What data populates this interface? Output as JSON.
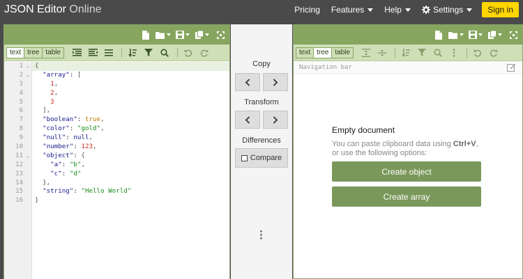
{
  "app": {
    "title_main": "JSON Editor",
    "title_sub": "Online"
  },
  "nav": {
    "pricing": "Pricing",
    "features": "Features",
    "help": "Help",
    "settings": "Settings",
    "signin": "Sign in"
  },
  "left_panel": {
    "modes": [
      "text",
      "tree",
      "table"
    ],
    "active_mode": "text",
    "line_numbers": [
      "1",
      "2",
      "3",
      "4",
      "5",
      "6",
      "7",
      "8",
      "9",
      "10",
      "11",
      "12",
      "13",
      "14",
      "15",
      "16"
    ],
    "code_lines": [
      "{",
      "  \"array\": [",
      "    1,",
      "    2,",
      "    3",
      "  ],",
      "  \"boolean\": true,",
      "  \"color\": \"gold\",",
      "  \"null\": null,",
      "  \"number\": 123,",
      "  \"object\": {",
      "    \"a\": \"b\",",
      "    \"c\": \"d\"",
      "  },",
      "  \"string\": \"Hello World\"",
      "}"
    ]
  },
  "middle": {
    "copy_label": "Copy",
    "transform_label": "Transform",
    "differences_label": "Differences",
    "compare_label": "Compare"
  },
  "right_panel": {
    "modes": [
      "text",
      "tree",
      "table"
    ],
    "active_mode": "tree",
    "navigation_bar": "Navigation bar",
    "empty_title": "Empty document",
    "hint_before": "You can paste clipboard data using ",
    "hint_shortcut": "Ctrl+V",
    "hint_after": ", or use the following options:",
    "create_object": "Create object",
    "create_array": "Create array"
  },
  "colors": {
    "accent": "#86a55e",
    "toolbar_bg": "#cfdfb8",
    "button_green": "#7a985a",
    "signin_yellow": "#ffd600",
    "topbar": "#4a4a4a"
  }
}
